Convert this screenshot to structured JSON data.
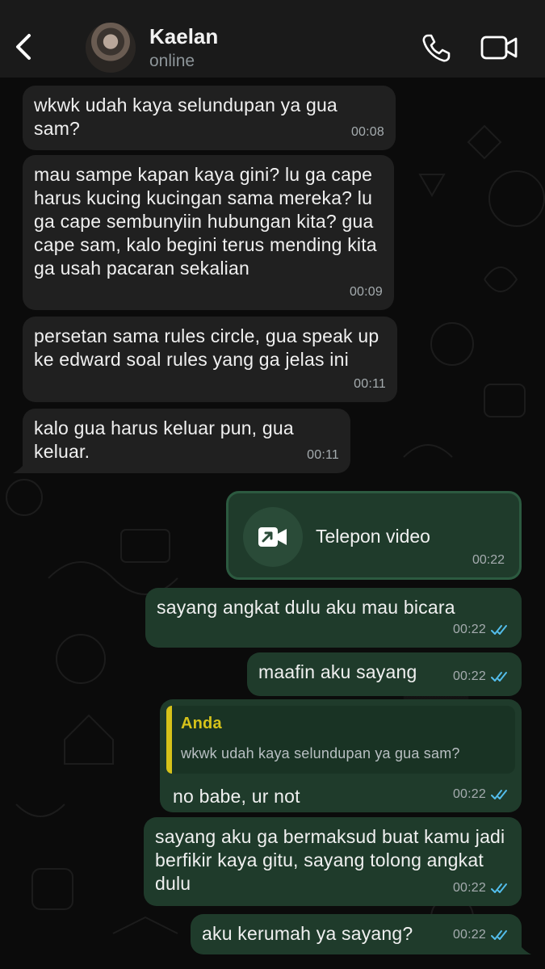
{
  "header": {
    "contact_name": "Kaelan",
    "status": "online"
  },
  "icons": {
    "back": "chevron-left-icon",
    "call": "phone-icon",
    "video": "video-camera-icon",
    "read": "double-check-icon"
  },
  "colors": {
    "header_bg": "#1a1a1a",
    "incoming_bubble": "#202020",
    "outgoing_bubble": "#1f3b2b",
    "read_ticks": "#53bdeb",
    "quote_accent": "#d6c21a"
  },
  "messages": [
    {
      "side": "in",
      "text": "wkwk udah kaya selundupan ya gua sam?",
      "time": "00:08"
    },
    {
      "side": "in",
      "text": "mau sampe kapan kaya gini? lu ga cape harus kucing kucingan sama mereka? lu ga cape sembunyiin hubungan kita? gua cape sam, kalo begini terus mending kita ga usah pacaran sekalian",
      "time": "00:09"
    },
    {
      "side": "in",
      "text": "persetan sama rules circle, gua speak up ke edward soal rules yang ga jelas ini",
      "time": "00:11"
    },
    {
      "side": "in",
      "text": "kalo gua harus keluar pun, gua keluar.",
      "time": "00:11"
    },
    {
      "side": "out",
      "type": "call",
      "text": "Telepon video",
      "time": "00:22"
    },
    {
      "side": "out",
      "text": "sayang angkat dulu aku mau bicara",
      "time": "00:22"
    },
    {
      "side": "out",
      "text": "maafin aku sayang",
      "time": "00:22"
    },
    {
      "side": "out",
      "reply_to": {
        "author": "Anda",
        "text": "wkwk udah kaya selundupan ya gua sam?"
      },
      "text": "no babe, ur not",
      "time": "00:22"
    },
    {
      "side": "out",
      "text": "sayang aku ga bermaksud buat kamu jadi berfikir kaya gitu, sayang tolong angkat dulu",
      "time": "00:22"
    },
    {
      "side": "out",
      "text": "aku kerumah ya sayang?",
      "time": "00:22"
    }
  ]
}
